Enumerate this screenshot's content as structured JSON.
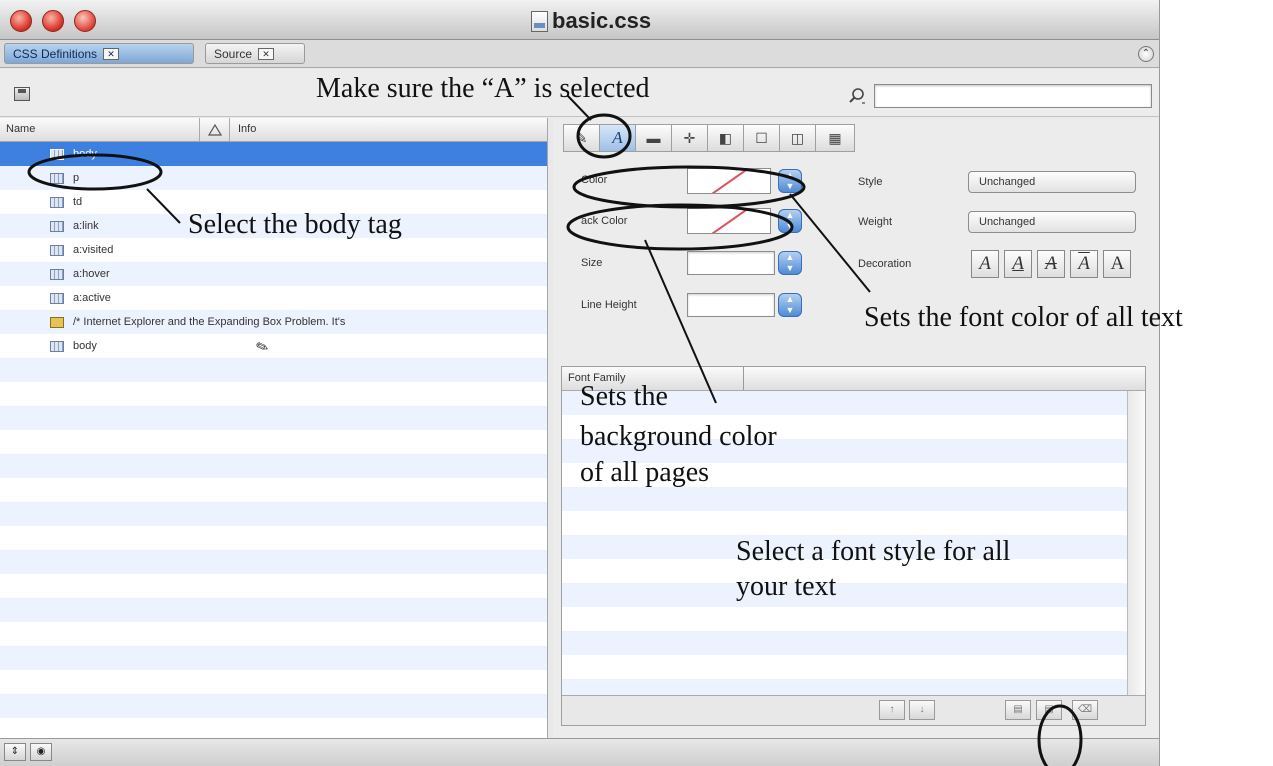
{
  "window": {
    "title": "basic.css"
  },
  "tabs": {
    "definitions": "CSS Definitions",
    "source": "Source"
  },
  "search": {
    "placeholder": ""
  },
  "rules": {
    "header": {
      "name": "Name",
      "info": "Info"
    },
    "items": [
      "body",
      "p",
      "td",
      "a:link",
      "a:visited",
      "a:hover",
      "a:active",
      "/* Internet Explorer and the Expanding Box Problem. It's",
      "body"
    ]
  },
  "props": {
    "color_label": "Color",
    "back_color_label": "ack Color",
    "size_label": "Size",
    "line_height_label": "Line Height",
    "style_label": "Style",
    "style_value": "Unchanged",
    "weight_label": "Weight",
    "weight_value": "Unchanged",
    "decoration_label": "Decoration",
    "font_family_header": "Font Family",
    "swatch_color": "#e0505a",
    "selected_row_color": "#3d80df"
  },
  "annotations": {
    "make_sure": "Make sure the “A” is selected",
    "select_body": "Select the body tag",
    "font_color": "Sets the font color of all text",
    "bg_color_1": "Sets the",
    "bg_color_2": "background color",
    "bg_color_3": "of all pages",
    "font_style_1": "Select a font style for all",
    "font_style_2": "your text"
  }
}
